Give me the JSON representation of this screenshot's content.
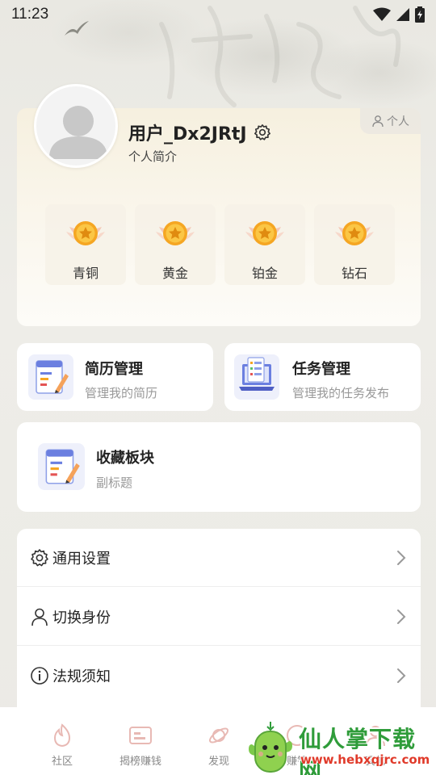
{
  "status_bar": {
    "time": "11:23"
  },
  "profile": {
    "username": "用户_Dx2JRtJ",
    "bio": "个人简介",
    "personal_tag": "个人",
    "levels": [
      {
        "label": "青铜"
      },
      {
        "label": "黄金"
      },
      {
        "label": "铂金"
      },
      {
        "label": "钻石"
      }
    ]
  },
  "cards": {
    "resume": {
      "title": "简历管理",
      "subtitle": "管理我的简历"
    },
    "task": {
      "title": "任务管理",
      "subtitle": "管理我的任务发布"
    },
    "favorites": {
      "title": "收藏板块",
      "subtitle": "副标题"
    }
  },
  "settings": [
    {
      "label": "通用设置",
      "icon": "gear-icon"
    },
    {
      "label": "切换身份",
      "icon": "person-icon"
    },
    {
      "label": "法规须知",
      "icon": "info-icon"
    }
  ],
  "bottom_nav": [
    {
      "label": "社区",
      "icon": "flame-icon"
    },
    {
      "label": "揭榜赚钱",
      "icon": "ticket-icon"
    },
    {
      "label": "发现",
      "icon": "orbit-icon"
    },
    {
      "label": "赚钱",
      "icon": "coin-icon"
    },
    {
      "label": "我的",
      "icon": "user-icon"
    }
  ],
  "watermark": {
    "title": "仙人掌下载网",
    "url": "www.hebxqjrc.com"
  },
  "colors": {
    "accent_gold": "#f5a623",
    "background": "#ecebe6",
    "watermark_green": "#2f9c3a",
    "watermark_red": "#e03a2a"
  }
}
